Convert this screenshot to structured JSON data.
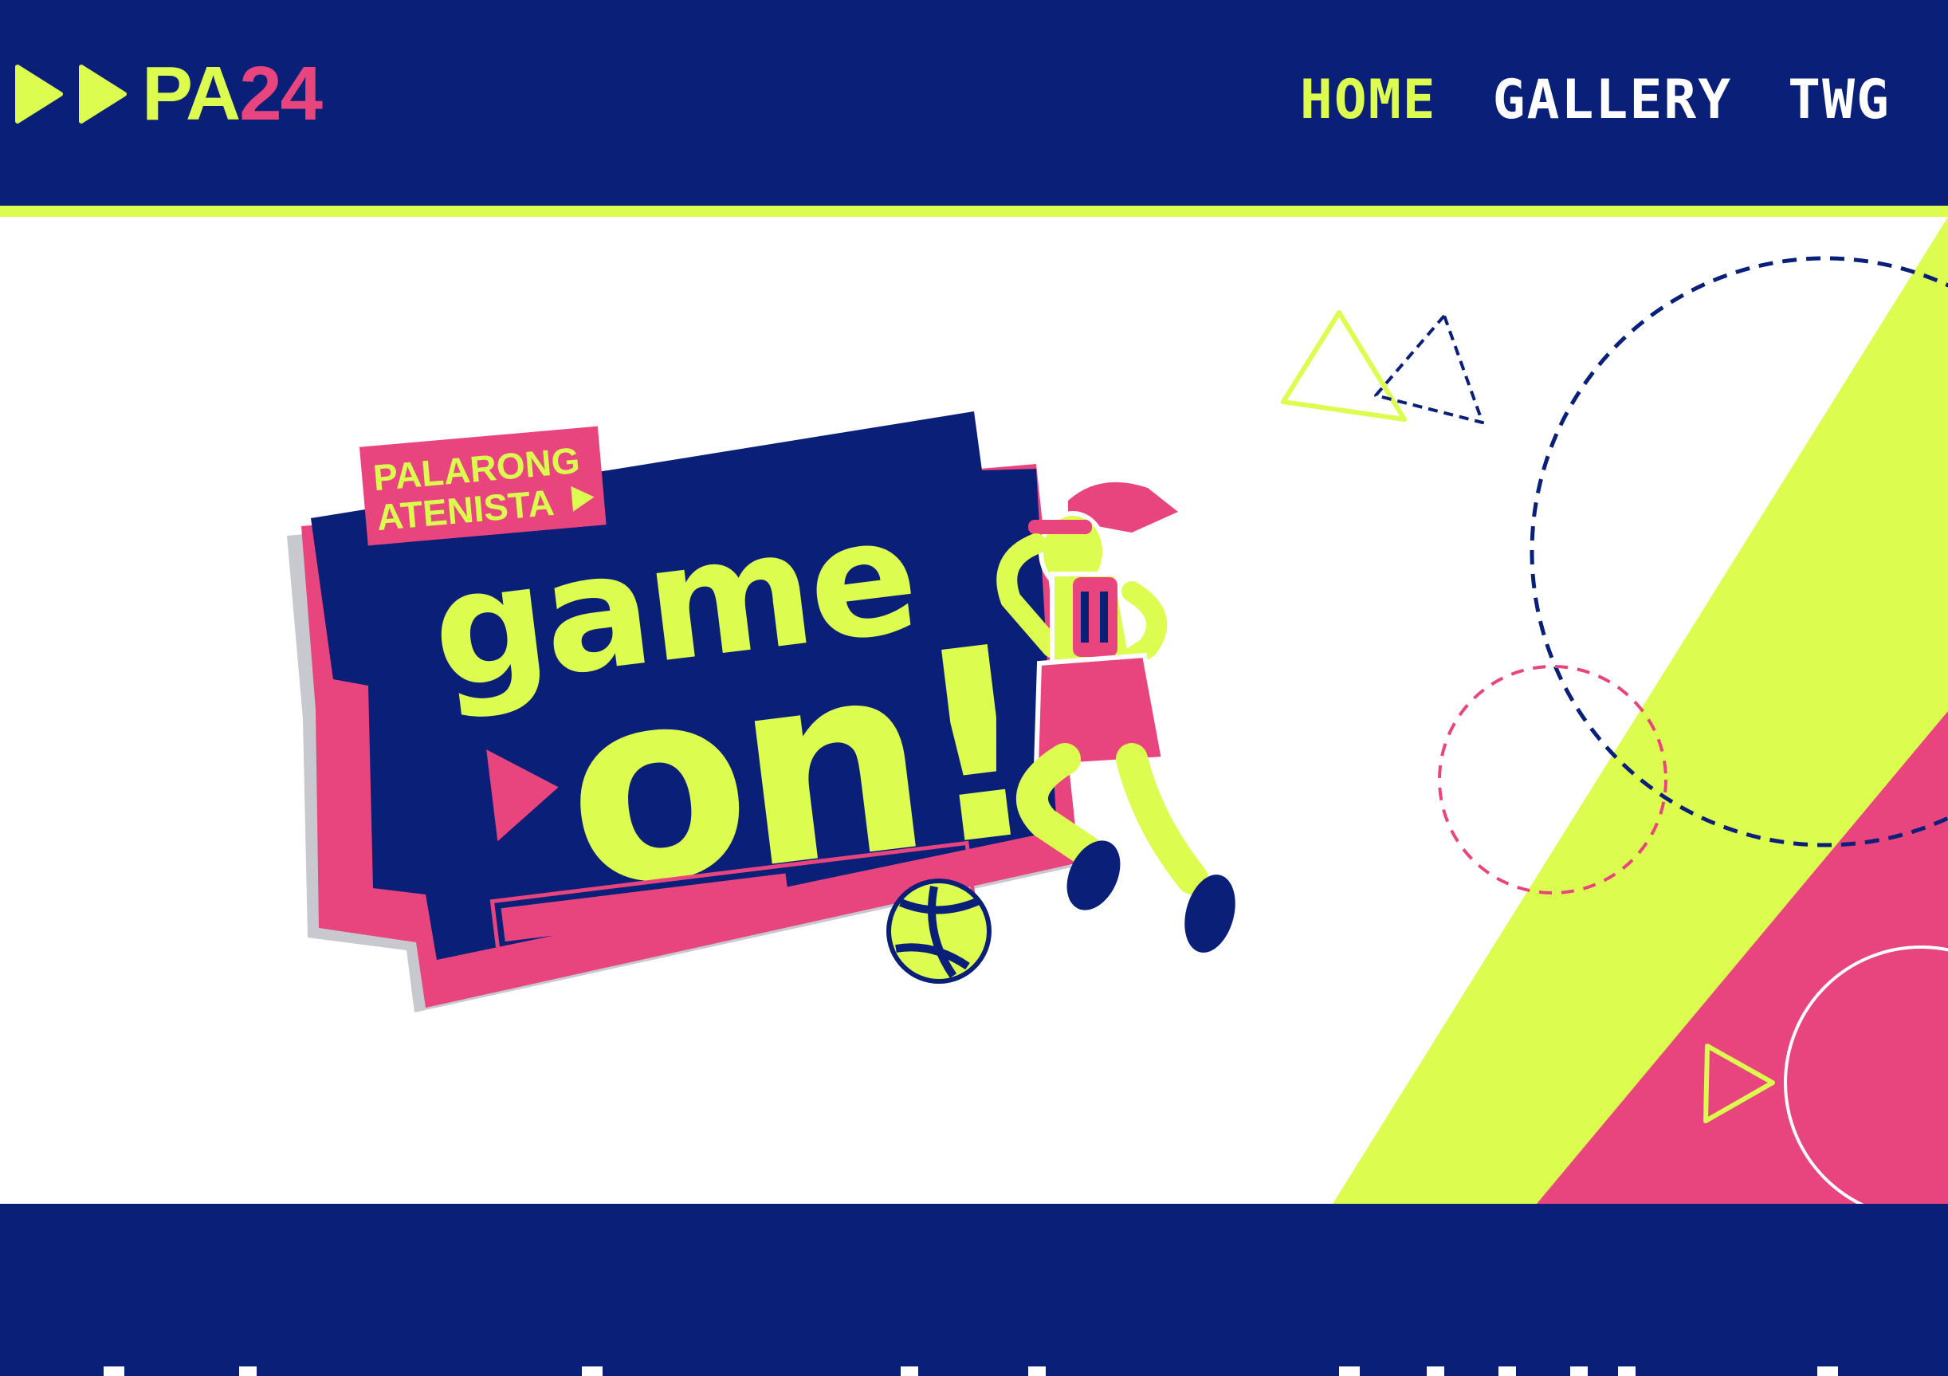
{
  "header": {
    "logo": {
      "prefix": "PA",
      "number": "24"
    },
    "nav": [
      {
        "label": "HOME",
        "active": true
      },
      {
        "label": "GALLERY",
        "active": false
      },
      {
        "label": "TWG",
        "active": false
      }
    ]
  },
  "hero": {
    "badge": {
      "kicker_line1": "PALARONG",
      "kicker_line2": "ATENISTA",
      "headline_line1": "game",
      "headline_line2": "on!",
      "progress": 0.62
    }
  },
  "colors": {
    "navy": "#0a1f78",
    "lime": "#dcfc50",
    "pink": "#e8457f",
    "white": "#ffffff"
  },
  "icons": [
    "double-play-arrow-icon",
    "play-triangle-icon",
    "volleyball-icon"
  ]
}
